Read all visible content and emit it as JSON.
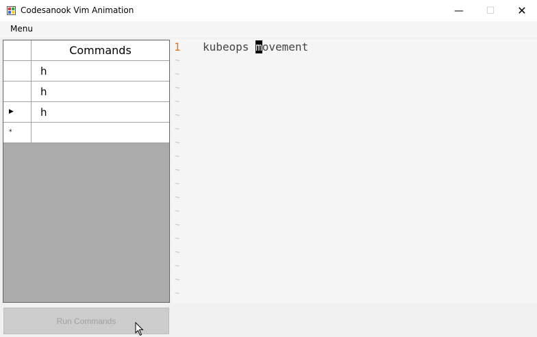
{
  "window": {
    "title": "Codesanook Vim Animation",
    "minimize_glyph": "—",
    "maximize_glyph": "☐",
    "close_glyph": "✕"
  },
  "menubar": {
    "menu_label": "Menu"
  },
  "commands_grid": {
    "header": "Commands",
    "rows": [
      {
        "value": "h",
        "marker": ""
      },
      {
        "value": "h",
        "marker": ""
      },
      {
        "value": "h",
        "marker": "▶"
      },
      {
        "value": "",
        "marker": "*"
      }
    ]
  },
  "editor": {
    "line_number": "1",
    "text_before_cursor": "kubeops ",
    "cursor_char": "m",
    "text_after_cursor": "ovement",
    "tilde": "~",
    "line_number_color": "#e8741c"
  },
  "run_button": {
    "label": "Run Commands",
    "enabled": false
  },
  "icons": [
    "app-icon",
    "minimize-icon",
    "maximize-icon",
    "close-icon",
    "mouse-pointer-icon"
  ]
}
